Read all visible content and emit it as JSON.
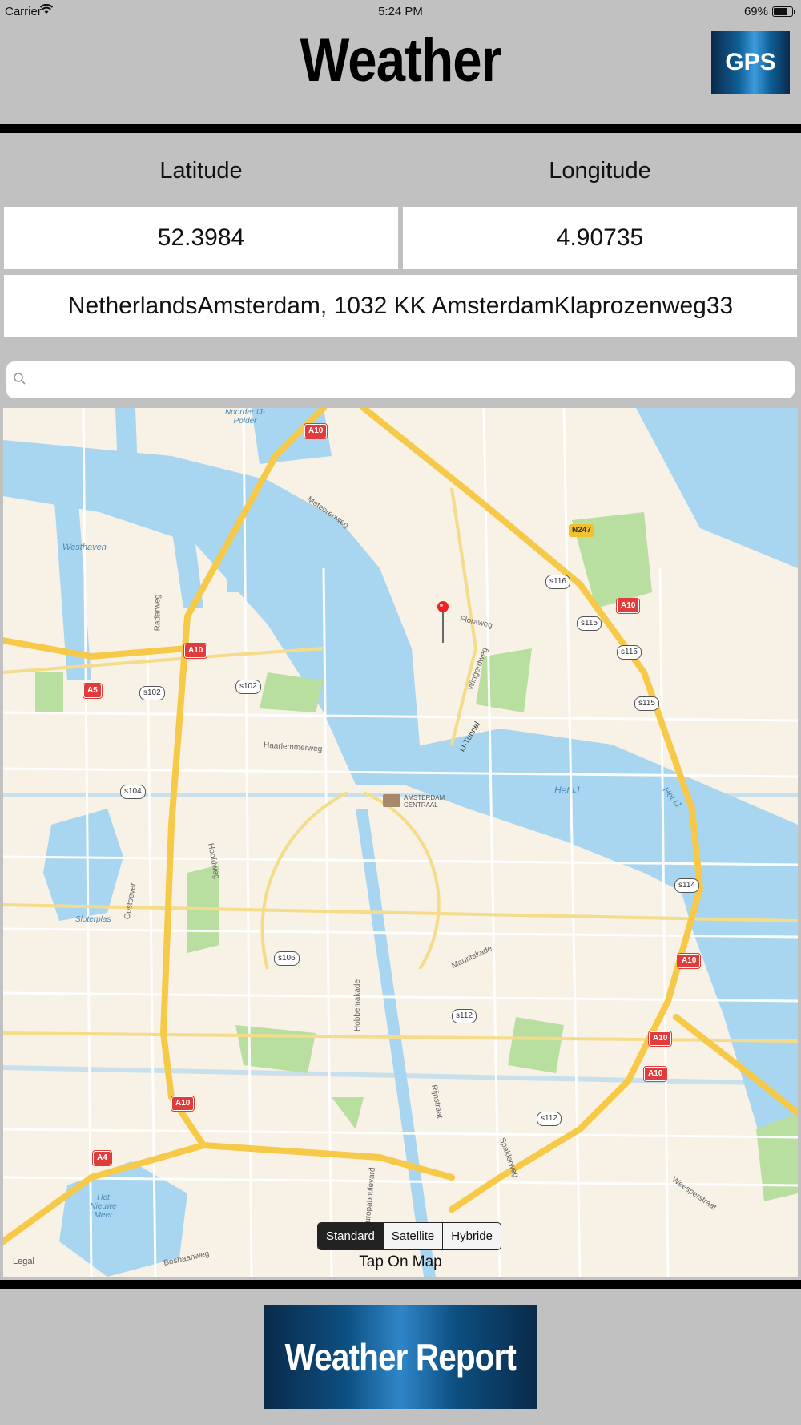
{
  "status_bar": {
    "carrier": "Carrier",
    "time": "5:24 PM",
    "battery": "69%",
    "battery_level": 0.69
  },
  "header": {
    "title": "Weather",
    "gps_label": "GPS"
  },
  "coords": {
    "latitude_label": "Latitude",
    "longitude_label": "Longitude",
    "latitude_value": "52.3984",
    "longitude_value": "4.90735",
    "address": "NetherlandsAmsterdam, 1032 KK AmsterdamKlaprozenweg33"
  },
  "search": {
    "placeholder": ""
  },
  "map": {
    "labels": {
      "westhaven": "Westhaven",
      "noorder": "Noorder IJ- Polder",
      "meteorenweg": "Meteorenweg",
      "radarweg": "Radarweg",
      "floraweg": "Floraweg",
      "wingerdweg": "Wingerdweg",
      "ijtunnel": "IJ-Tunnel",
      "haarlemmerweg": "Haarlemmerweg",
      "amsterdam_centraal": "AMSTERDAM CENTRAAL",
      "het_ij": "Het IJ",
      "het_ij2": "Het IJ",
      "hoofdweg": "Hoofdweg",
      "oostoever": "Oostoever",
      "sloterplas": "Sloterplas",
      "mauritskade": "Mauritskade",
      "hobbemakade": "Hobbemakade",
      "rijnstraat": "Rijnstraat",
      "europaboulevard": "Europaboulevard",
      "spaklerweg": "Spaklerweg",
      "weesperstraat": "Weesperstraat",
      "het_nieuwe_meer": "Het Nieuwe Meer",
      "bosbaanweg": "Bosbaanweg"
    },
    "shields": {
      "a10_1": "A10",
      "a10_2": "A10",
      "a10_3": "A10",
      "a10_4": "A10",
      "a10_5": "A10",
      "a10_6": "A10",
      "a10_7": "A10",
      "a5": "A5",
      "a4": "A4",
      "n247": "N247",
      "s102a": "s102",
      "s102b": "s102",
      "s104": "s104",
      "s106": "s106",
      "s112a": "s112",
      "s112b": "s112",
      "s114": "s114",
      "s115a": "s115",
      "s115b": "s115",
      "s115c": "s115",
      "s116": "s116"
    },
    "pin_icon": "red-map-pin",
    "map_types": [
      "Standard",
      "Satellite",
      "Hybride"
    ],
    "selected_map_type": "Standard",
    "tap_hint": "Tap On Map",
    "legal": "Legal"
  },
  "footer": {
    "report_label": "Weather Report"
  },
  "colors": {
    "background": "#c1c1c1",
    "button_blue": "#0f5f96",
    "water": "#a8d5f0",
    "highway": "#f7c948",
    "park": "#b9dfa0"
  }
}
